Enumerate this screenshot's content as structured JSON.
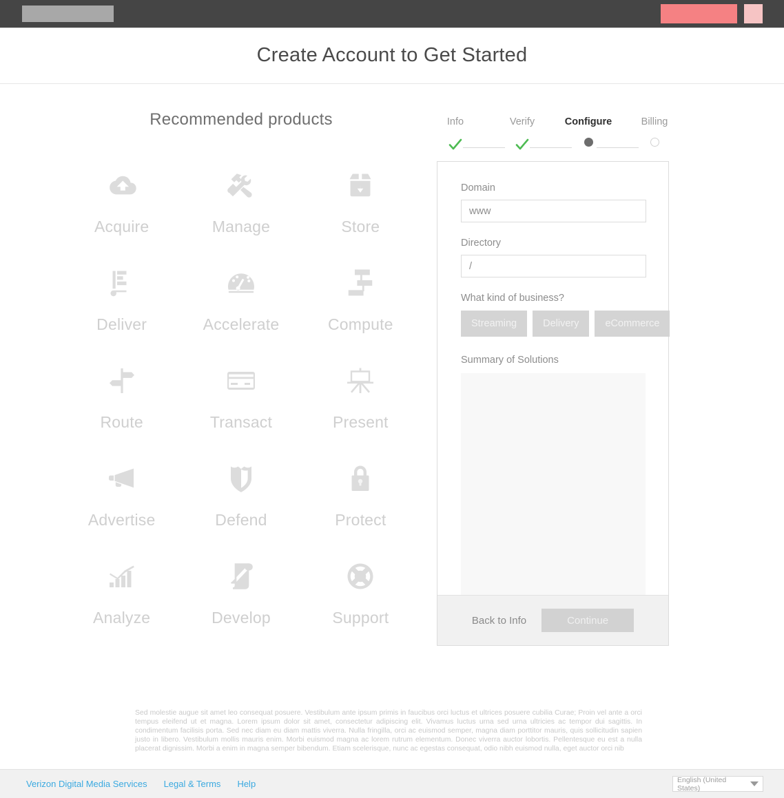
{
  "topbar": {
    "logo_placeholder": "logo-placeholder",
    "brand_block_large_color": "#f58183",
    "brand_block_small_color": "#f6c4c4",
    "background_color": "#454545"
  },
  "page_title": "Create Account to Get Started",
  "products": {
    "heading": "Recommended products",
    "items": [
      {
        "label": "Acquire",
        "icon": "cloud-upload-icon"
      },
      {
        "label": "Manage",
        "icon": "tools-icon"
      },
      {
        "label": "Store",
        "icon": "box-download-icon"
      },
      {
        "label": "Deliver",
        "icon": "hand-truck-icon"
      },
      {
        "label": "Accelerate",
        "icon": "speedometer-icon"
      },
      {
        "label": "Compute",
        "icon": "sitemap-icon"
      },
      {
        "label": "Route",
        "icon": "signpost-icon"
      },
      {
        "label": "Transact",
        "icon": "credit-card-icon"
      },
      {
        "label": "Present",
        "icon": "easel-icon"
      },
      {
        "label": "Advertise",
        "icon": "megaphone-icon"
      },
      {
        "label": "Defend",
        "icon": "shield-icon"
      },
      {
        "label": "Protect",
        "icon": "lock-icon"
      },
      {
        "label": "Analyze",
        "icon": "bar-chart-icon"
      },
      {
        "label": "Develop",
        "icon": "scroll-icon"
      },
      {
        "label": "Support",
        "icon": "life-ring-icon"
      }
    ]
  },
  "wizard": {
    "steps": [
      {
        "label": "Info",
        "state": "complete",
        "mark": "check-icon"
      },
      {
        "label": "Verify",
        "state": "complete",
        "mark": "check-icon"
      },
      {
        "label": "Configure",
        "state": "active",
        "mark": "filled-dot"
      },
      {
        "label": "Billing",
        "state": "pending",
        "mark": "empty-dot"
      }
    ],
    "complete_color": "#4dbb52",
    "active_color": "#6d6d6d",
    "form": {
      "domain_label": "Domain",
      "domain_value": "www",
      "domain_placeholder": "www",
      "directory_label": "Directory",
      "directory_value": "/",
      "directory_placeholder": "/",
      "business_label": "What kind of business?",
      "business_options": [
        "Streaming",
        "Delivery",
        "eCommerce"
      ],
      "summary_label": "Summary of Solutions",
      "summary_content": ""
    },
    "footer": {
      "back_label": "Back to Info",
      "continue_label": "Continue"
    }
  },
  "disclaimer": "Sed molestie augue sit amet leo consequat posuere. Vestibulum ante ipsum primis in faucibus orci luctus et ultrices posuere cubilia Curae; Proin vel ante a orci tempus eleifend ut et magna. Lorem ipsum dolor sit amet, consectetur adipiscing elit. Vivamus luctus urna sed urna ultricies ac tempor dui sagittis. In condimentum facilisis porta. Sed nec diam eu diam mattis viverra. Nulla fringilla, orci ac euismod semper, magna diam porttitor mauris, quis sollicitudin sapien justo in libero. Vestibulum mollis mauris enim. Morbi euismod magna ac lorem rutrum elementum. Donec viverra auctor lobortis. Pellentesque eu est a nulla placerat dignissim. Morbi a enim in magna semper bibendum. Etiam scelerisque, nunc ac egestas consequat, odio nibh euismod nulla, eget auctor orci nib",
  "footer": {
    "links": [
      "Verizon Digital Media Services",
      "Legal & Terms",
      "Help"
    ],
    "link_color": "#3aa9e0",
    "language": "English (United States)",
    "caret_icon": "chevron-down-icon"
  }
}
